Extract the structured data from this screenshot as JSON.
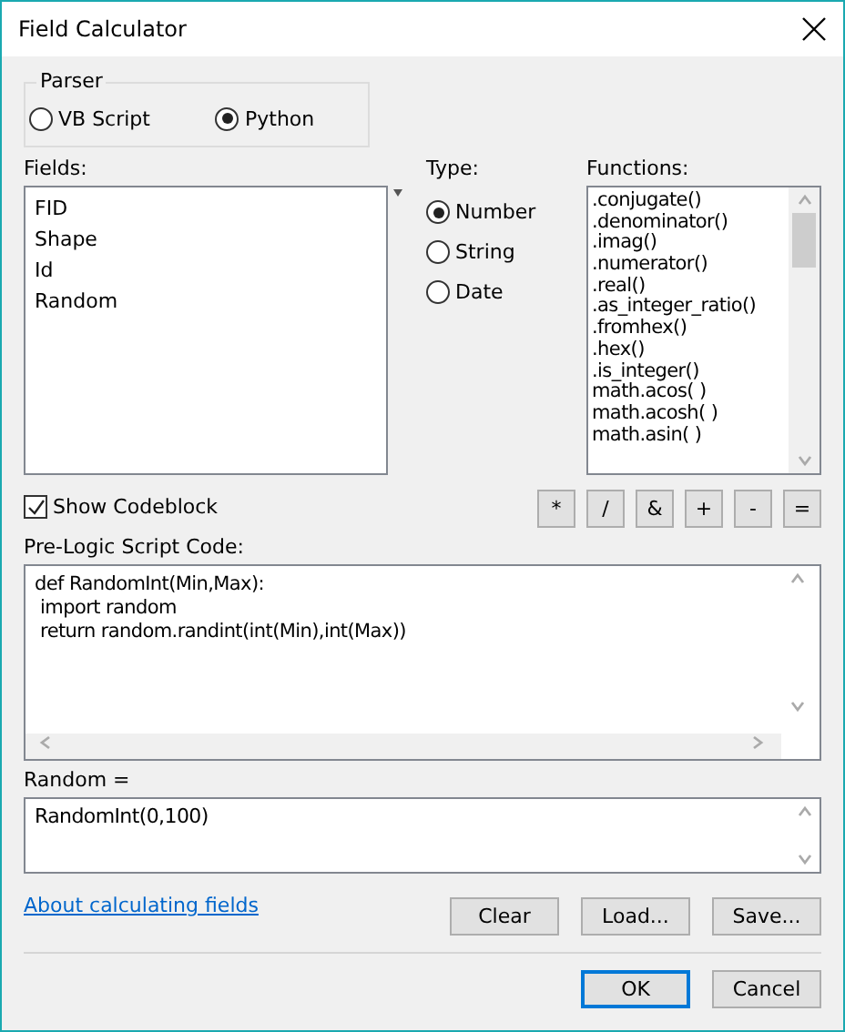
{
  "window": {
    "title": "Field Calculator"
  },
  "parser": {
    "label": "Parser",
    "options": [
      {
        "label": "VB Script",
        "selected": false
      },
      {
        "label": "Python",
        "selected": true
      }
    ]
  },
  "fields": {
    "label": "Fields:",
    "items": [
      "FID",
      "Shape",
      "Id",
      "Random"
    ]
  },
  "type": {
    "label": "Type:",
    "options": [
      {
        "label": "Number",
        "selected": true
      },
      {
        "label": "String",
        "selected": false
      },
      {
        "label": "Date",
        "selected": false
      }
    ]
  },
  "functions": {
    "label": "Functions:",
    "items": [
      ".conjugate()",
      ".denominator()",
      ".imag()",
      ".numerator()",
      ".real()",
      ".as_integer_ratio()",
      ".fromhex()",
      ".hex()",
      ".is_integer()",
      "math.acos( )",
      "math.acosh( )",
      "math.asin( )"
    ]
  },
  "show_codeblock": {
    "label": "Show Codeblock",
    "checked": true
  },
  "operators": [
    "*",
    "/",
    "&",
    "+",
    "-",
    "="
  ],
  "pre_logic": {
    "label": "Pre-Logic Script Code:",
    "lines": [
      "def RandomInt(Min,Max):",
      " import random",
      " return random.randint(int(Min),int(Max))"
    ]
  },
  "expression": {
    "label": "Random =",
    "value": "RandomInt(0,100)"
  },
  "help_link": "About calculating fields",
  "file_buttons": [
    "Clear",
    "Load...",
    "Save..."
  ],
  "dialog_buttons": [
    {
      "label": "OK",
      "default": true
    },
    {
      "label": "Cancel",
      "default": false
    }
  ]
}
